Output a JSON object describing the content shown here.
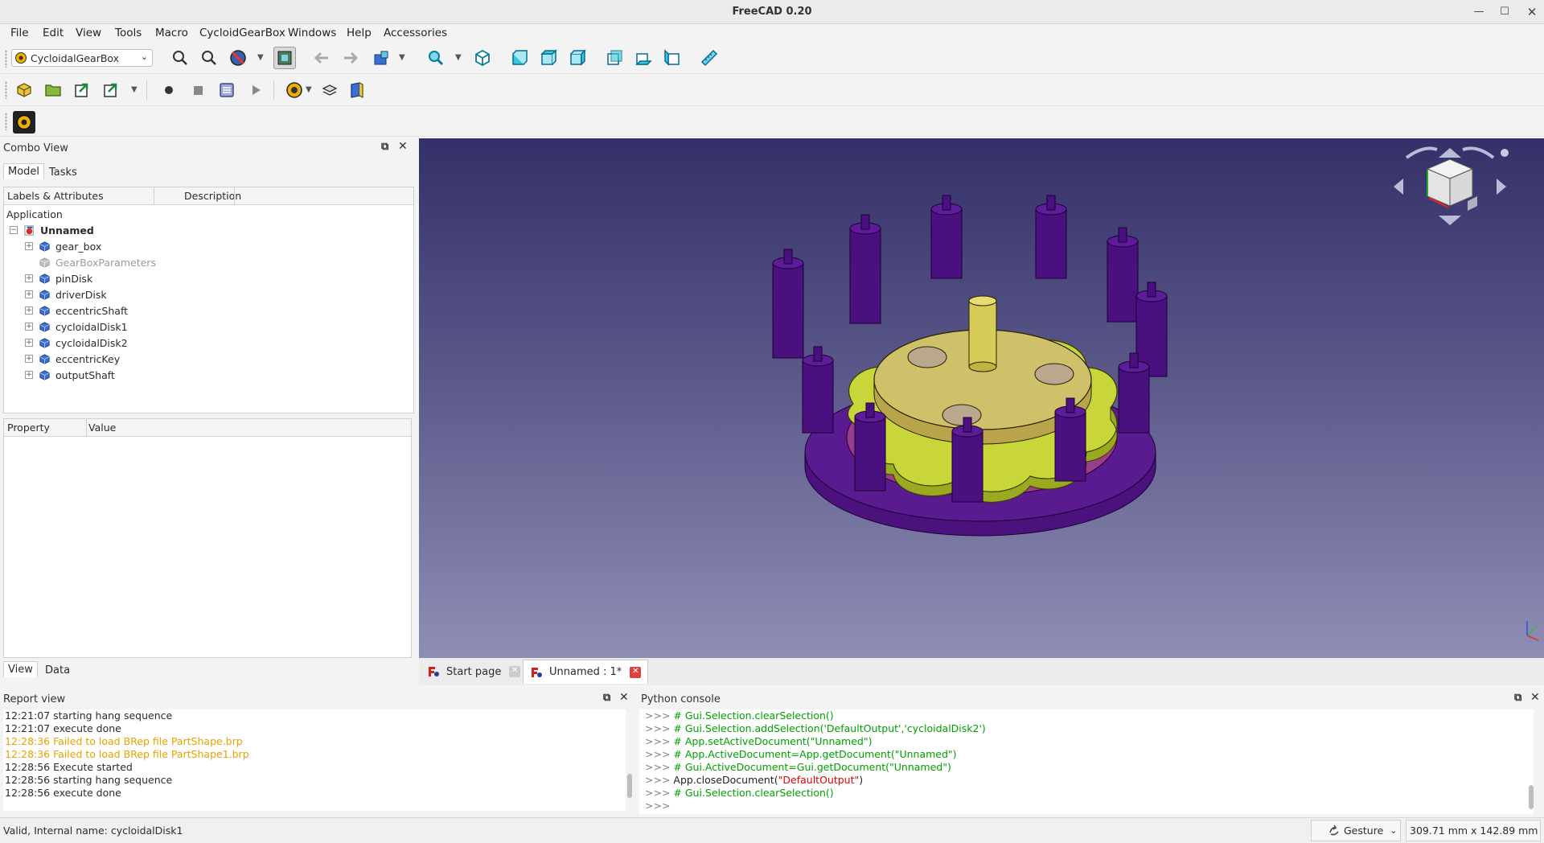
{
  "window": {
    "title": "FreeCAD 0.20"
  },
  "menu": [
    "File",
    "Edit",
    "View",
    "Tools",
    "Macro",
    "CycloidGearBox",
    "Windows",
    "Help",
    "Accessories"
  ],
  "workbench": {
    "selected": "CycloidalGearBox"
  },
  "combo_view": {
    "title": "Combo View",
    "tabs": [
      "Model",
      "Tasks"
    ],
    "tree_columns": [
      "Labels & Attributes",
      "Description"
    ],
    "root": "Application",
    "document": "Unnamed",
    "items": [
      "gear_box",
      "GearBoxParameters",
      "pinDisk",
      "driverDisk",
      "eccentricShaft",
      "cycloidalDisk1",
      "cycloidalDisk2",
      "eccentricKey",
      "outputShaft"
    ],
    "prop_columns": [
      "Property",
      "Value"
    ],
    "bottom_tabs": [
      "View",
      "Data"
    ]
  },
  "doc_tabs": [
    "Start page",
    "Unnamed : 1*"
  ],
  "report": {
    "title": "Report view",
    "lines": [
      {
        "text": "12:21:07  starting hang sequence",
        "warn": false
      },
      {
        "text": "12:21:07  execute done",
        "warn": false
      },
      {
        "text": "12:28:36  Failed to load BRep file PartShape.brp",
        "warn": true
      },
      {
        "text": "12:28:36  Failed to load BRep file PartShape1.brp",
        "warn": true
      },
      {
        "text": "12:28:56  Execute started",
        "warn": false
      },
      {
        "text": "12:28:56  starting hang sequence",
        "warn": false
      },
      {
        "text": "12:28:56  execute done",
        "warn": false
      }
    ]
  },
  "console": {
    "title": "Python console",
    "prompt": ">>>",
    "lines": [
      "# Gui.Selection.clearSelection()",
      "# Gui.Selection.addSelection('DefaultOutput','cycloidalDisk2')",
      "# App.setActiveDocument(\"Unnamed\")",
      "# App.ActiveDocument=App.getDocument(\"Unnamed\")",
      "# Gui.ActiveDocument=Gui.getDocument(\"Unnamed\")",
      "App.closeDocument(",
      "# Gui.Selection.clearSelection()",
      ""
    ],
    "close_arg": "\"DefaultOutput\"",
    "close_end": ")"
  },
  "status": {
    "message": "Valid, Internal name: cycloidalDisk1",
    "navigation": "Gesture",
    "dimensions": "309.71 mm x 142.89 mm"
  },
  "colors": {
    "pins": "#4a1080",
    "disk_yellow": "#c8d63a",
    "disk_pink": "#9a3d8c",
    "base": "#4b127e",
    "bg_top": "#343069",
    "bg_bottom": "#8e8eb5"
  }
}
